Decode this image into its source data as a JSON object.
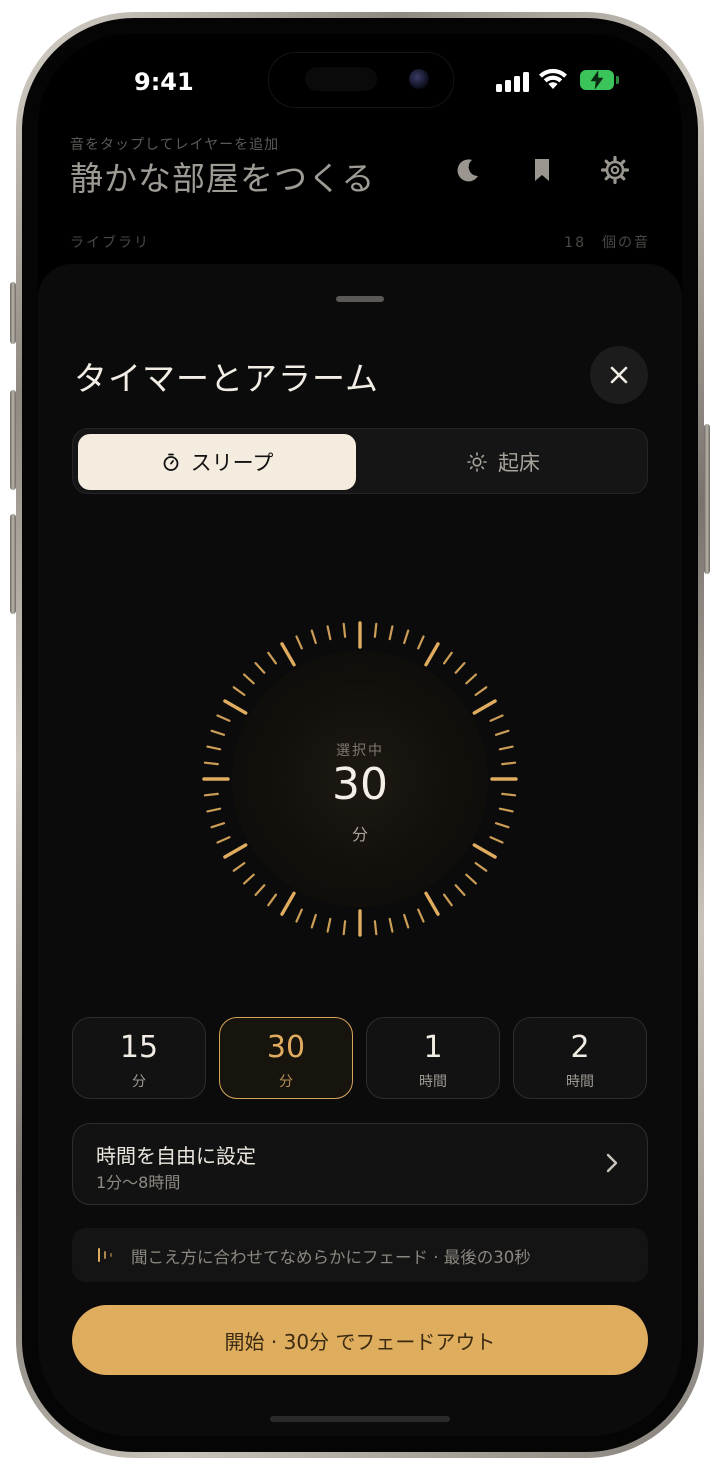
{
  "status_bar": {
    "time": "9:41"
  },
  "header": {
    "hint": "音をタップしてレイヤーを追加",
    "title": "静かな部屋をつくる",
    "icons": [
      "moon-icon",
      "bookmark-icon",
      "gear-icon"
    ]
  },
  "library": {
    "label": "ライブラリ",
    "count": "18　個の音"
  },
  "sheet": {
    "title": "タイマーとアラーム",
    "tabs": [
      {
        "label": "スリープ",
        "icon": "stopwatch-icon",
        "selected": true
      },
      {
        "label": "起床",
        "icon": "sun-icon",
        "selected": false
      }
    ],
    "dial": {
      "caption": "選択中",
      "value": "30",
      "unit": "分",
      "accent": "#e0ad60"
    },
    "presets": [
      {
        "value": "15",
        "unit": "分",
        "selected": false
      },
      {
        "value": "30",
        "unit": "分",
        "selected": true
      },
      {
        "value": "1",
        "unit": "時間",
        "selected": false
      },
      {
        "value": "2",
        "unit": "時間",
        "selected": false
      }
    ],
    "custom": {
      "title": "時間を自由に設定",
      "subtitle": "1分〜8時間"
    },
    "fade_note": "聞こえ方に合わせてなめらかにフェード · 最後の30秒",
    "start_button": "開始 · 30分 でフェードアウト"
  },
  "colors": {
    "accent": "#dfad5e",
    "background": "#000000",
    "sheet": "#0b0b0b"
  }
}
